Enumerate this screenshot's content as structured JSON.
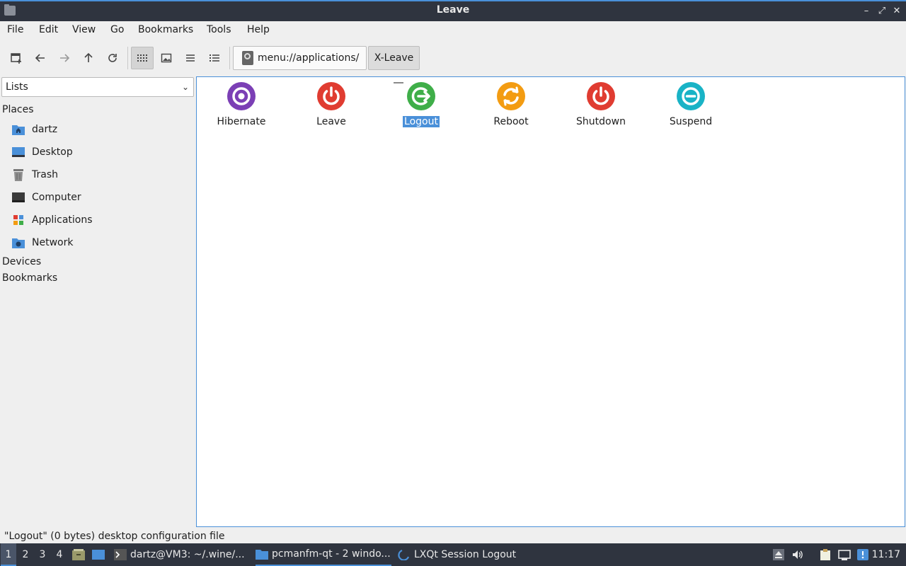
{
  "window": {
    "title": "Leave"
  },
  "menu": [
    "File",
    "Edit",
    "View",
    "Go",
    "Bookmarks",
    "Tools",
    "Help"
  ],
  "toolbar": {
    "path": "menu://applications/",
    "crumb": "X-Leave"
  },
  "sidepane": {
    "mode": "Lists",
    "places_header": "Places",
    "places": [
      {
        "label": "dartz",
        "icon": "home-folder-icon"
      },
      {
        "label": "Desktop",
        "icon": "desktop-icon"
      },
      {
        "label": "Trash",
        "icon": "trash-icon"
      },
      {
        "label": "Computer",
        "icon": "computer-icon"
      },
      {
        "label": "Applications",
        "icon": "applications-icon"
      },
      {
        "label": "Network",
        "icon": "network-icon"
      }
    ],
    "devices_header": "Devices",
    "bookmarks_header": "Bookmarks"
  },
  "files": [
    {
      "label": "Hibernate",
      "color": "#7b3fb5",
      "icon": "hibernate-icon"
    },
    {
      "label": "Leave",
      "color": "#e03c31",
      "icon": "power-icon"
    },
    {
      "label": "Logout",
      "color": "#3fae49",
      "icon": "logout-icon",
      "selected": true
    },
    {
      "label": "Reboot",
      "color": "#f39c12",
      "icon": "reboot-icon"
    },
    {
      "label": "Shutdown",
      "color": "#e03c31",
      "icon": "shutdown-icon"
    },
    {
      "label": "Suspend",
      "color": "#19b3c6",
      "icon": "suspend-icon"
    }
  ],
  "status": "\"Logout\" (0 bytes) desktop configuration file",
  "taskbar": {
    "desktops": [
      "1",
      "2",
      "3",
      "4"
    ],
    "tasks": [
      {
        "label": "dartz@VM3: ~/.wine/..."
      },
      {
        "label": "pcmanfm-qt - 2 windo..."
      },
      {
        "label": "LXQt Session Logout"
      }
    ],
    "clock": "11:17"
  },
  "colors": {
    "accent": "#4a90d9",
    "titlebar": "#2f343f"
  }
}
